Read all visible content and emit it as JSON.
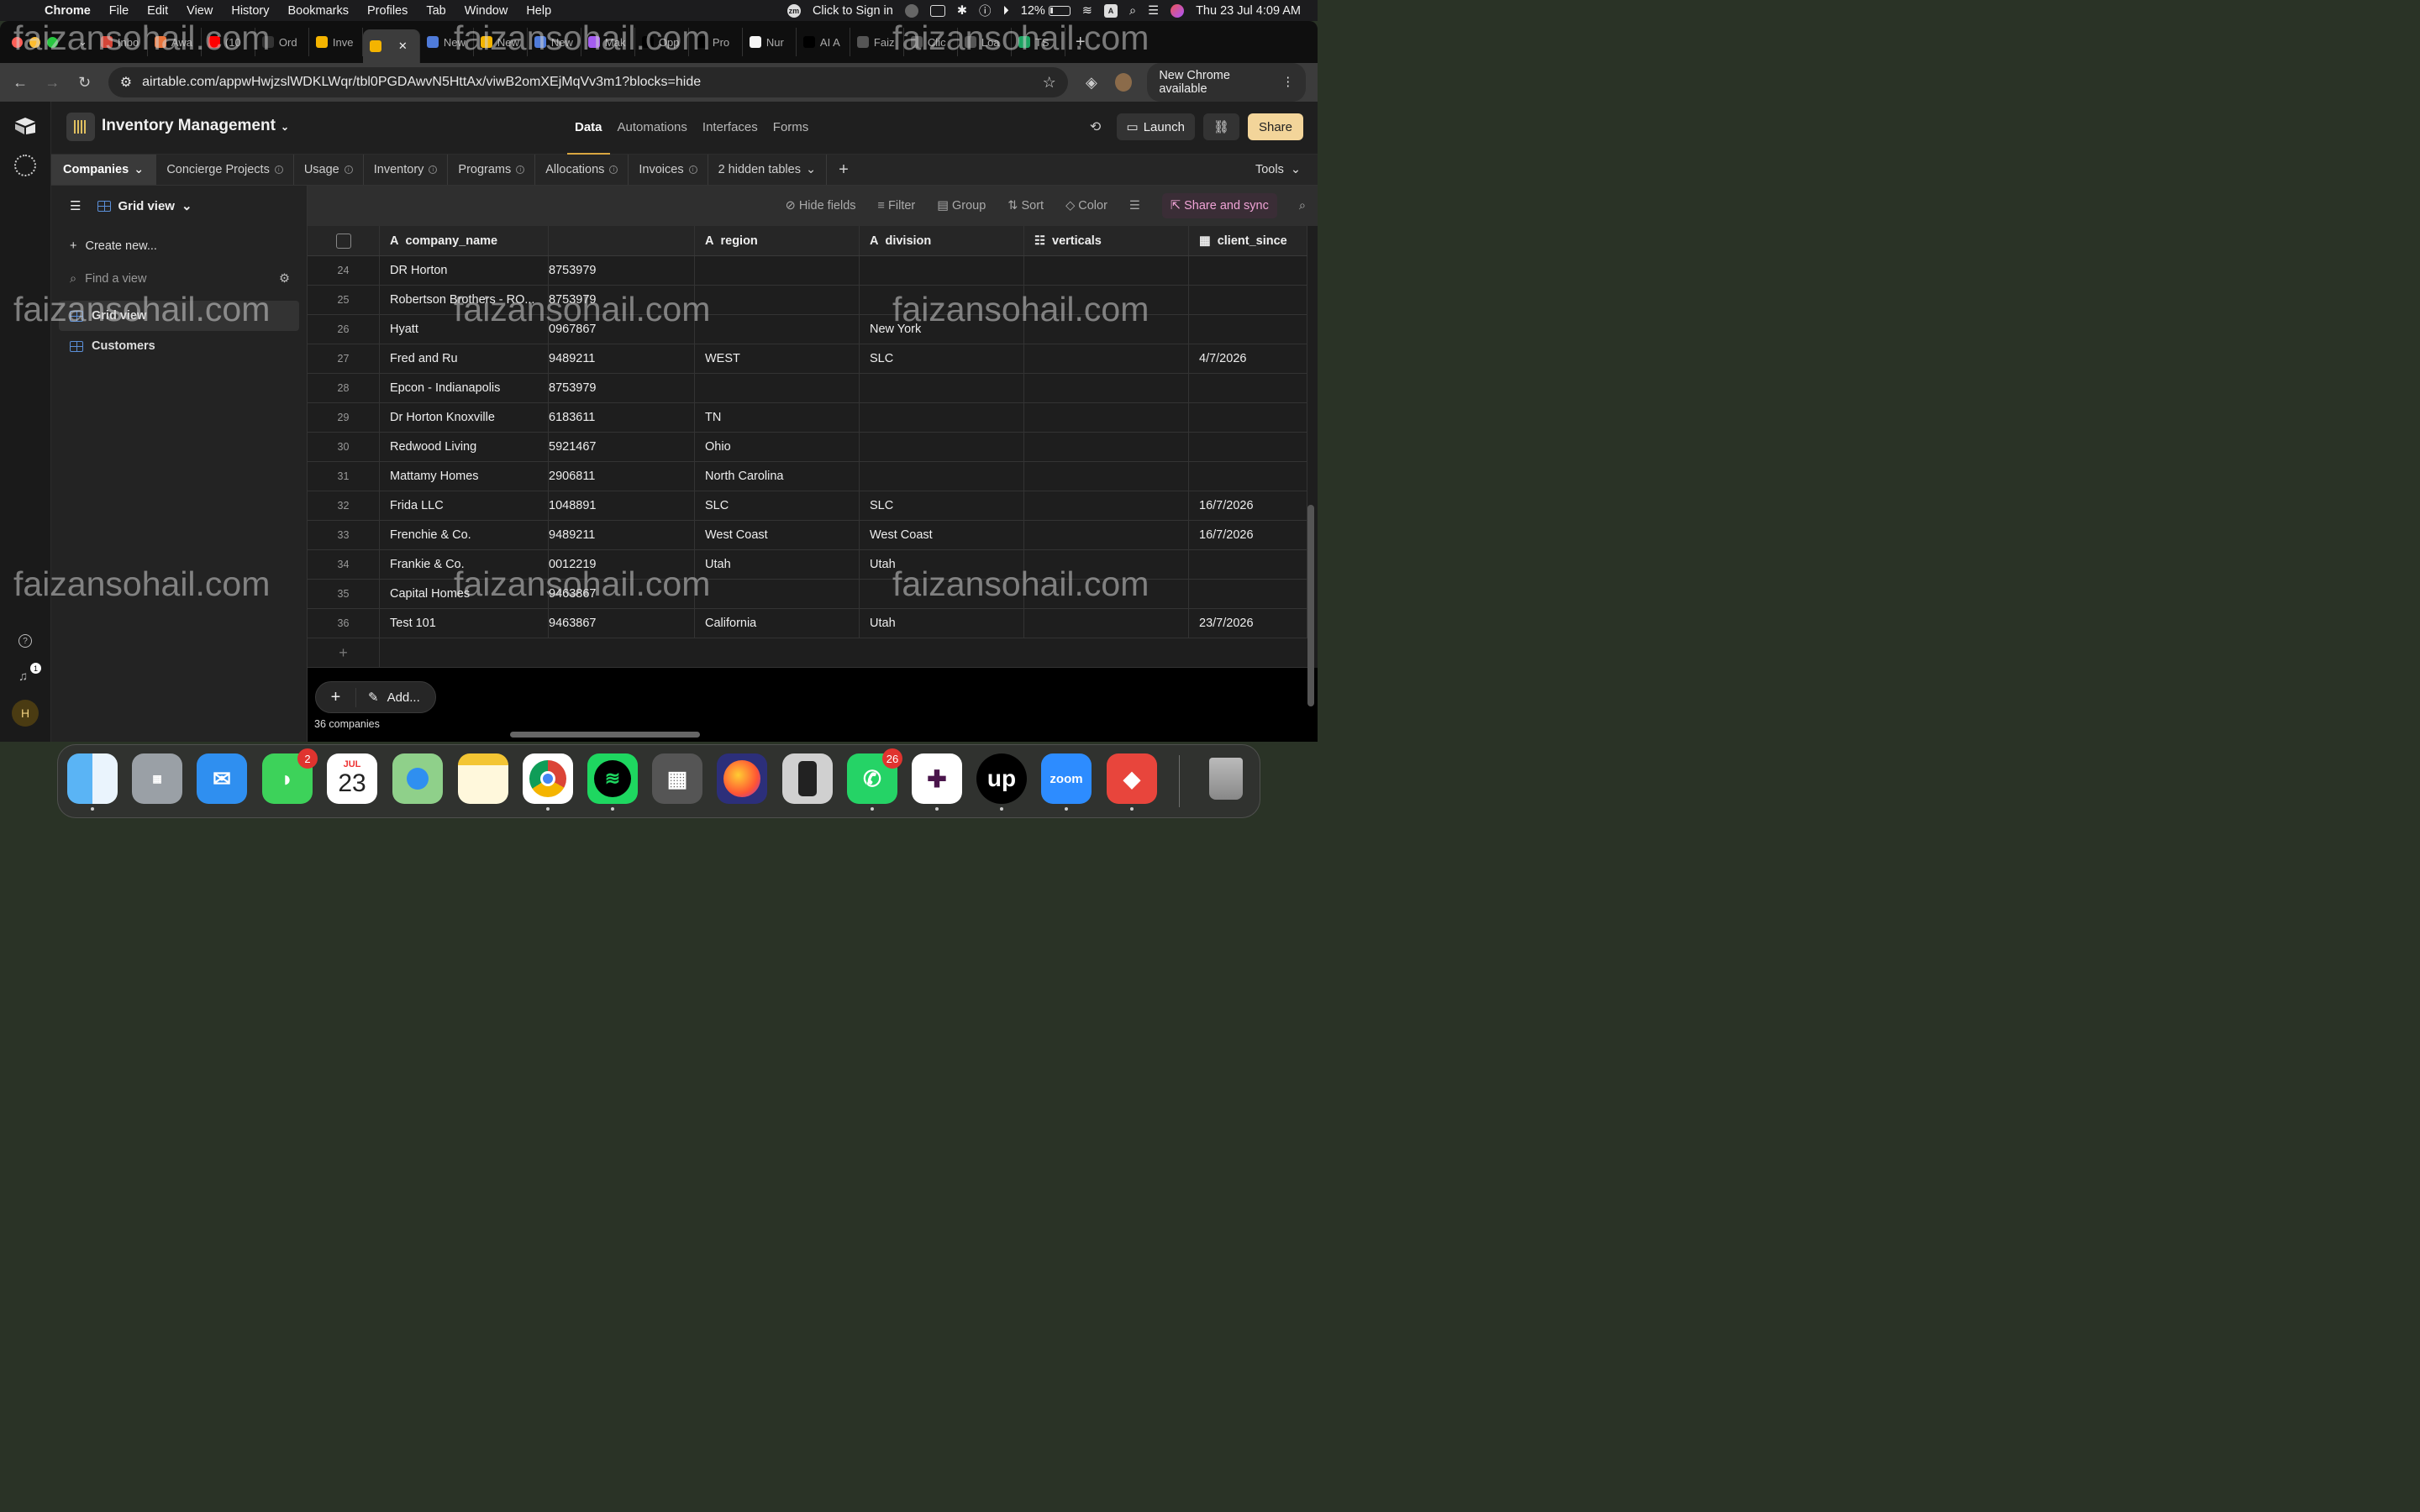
{
  "menubar": {
    "app": "Chrome",
    "items": [
      "File",
      "Edit",
      "View",
      "History",
      "Bookmarks",
      "Profiles",
      "Tab",
      "Window",
      "Help"
    ],
    "zm": "zm",
    "signin": "Click to Sign in",
    "battery": "12%",
    "input": "A",
    "datetime": "Thu 23 Jul  4:09 AM"
  },
  "browser": {
    "tabs": [
      {
        "label": "Inbo",
        "color": "#d44638"
      },
      {
        "label": "Awa",
        "color": "#e8743b"
      },
      {
        "label": "(10",
        "color": "#ff0000"
      },
      {
        "label": "Ord",
        "color": "#333333"
      },
      {
        "label": "Inve",
        "color": "#f4b400"
      },
      {
        "label": "New",
        "color": "#4f7bd9"
      },
      {
        "label": "New",
        "color": "#f4b400"
      },
      {
        "label": "New",
        "color": "#4f7bd9"
      },
      {
        "label": "Mak",
        "color": "#a45cf0"
      },
      {
        "label": "Opp",
        "color": "#000000"
      },
      {
        "label": "Pro",
        "color": "#000000"
      },
      {
        "label": "Nur",
        "color": "#f5f5f5"
      },
      {
        "label": "AI A",
        "color": "#000000"
      },
      {
        "label": "Faiz",
        "color": "#555555"
      },
      {
        "label": "Clic",
        "color": "#555555"
      },
      {
        "label": "Loa",
        "color": "#555555"
      },
      {
        "label": "TS",
        "color": "#1da462"
      }
    ],
    "url": "airtable.com/appwHwjzslWDKLWqr/tbl0PGDAwvN5HttAx/viwB2omXEjMqVv3m1?blocks=hide",
    "update": "New Chrome available"
  },
  "base": {
    "name": "Inventory Management",
    "nav": [
      "Data",
      "Automations",
      "Interfaces",
      "Forms"
    ],
    "launch": "Launch",
    "share": "Share"
  },
  "tables": {
    "active": "Companies",
    "items": [
      "Concierge Projects",
      "Usage",
      "Inventory",
      "Programs",
      "Allocations",
      "Invoices"
    ],
    "hidden": "2 hidden tables",
    "tools": "Tools"
  },
  "sidebar": {
    "view_name": "Grid view",
    "create": "Create new...",
    "find_placeholder": "Find a view",
    "views": [
      "Grid view",
      "Customers"
    ]
  },
  "viewbar": {
    "hide_fields": "Hide fields",
    "filter": "Filter",
    "group": "Group",
    "sort": "Sort",
    "color": "Color",
    "share_sync": "Share and sync"
  },
  "grid": {
    "columns": [
      "company_name",
      "",
      "region",
      "division",
      "verticals",
      "client_since"
    ],
    "rows": [
      {
        "n": "24",
        "name": "DR Horton",
        "id": "8753979",
        "region": "",
        "division": "",
        "verticals": "",
        "since": ""
      },
      {
        "n": "25",
        "name": "Robertson Brothers - RO...",
        "id": "8753979",
        "region": "",
        "division": "",
        "verticals": "",
        "since": ""
      },
      {
        "n": "26",
        "name": "Hyatt",
        "id": "0967867",
        "region": "",
        "division": "New York",
        "verticals": "",
        "since": ""
      },
      {
        "n": "27",
        "name": "Fred and Ru",
        "id": "9489211",
        "region": "WEST",
        "division": "SLC",
        "verticals": "",
        "since": "4/7/2026"
      },
      {
        "n": "28",
        "name": "Epcon - Indianapolis",
        "id": "8753979",
        "region": "",
        "division": "",
        "verticals": "",
        "since": ""
      },
      {
        "n": "29",
        "name": "Dr Horton Knoxville",
        "id": "6183611",
        "region": "TN",
        "division": "",
        "verticals": "",
        "since": ""
      },
      {
        "n": "30",
        "name": "Redwood Living",
        "id": "5921467",
        "region": "Ohio",
        "division": "",
        "verticals": "",
        "since": ""
      },
      {
        "n": "31",
        "name": "Mattamy Homes",
        "id": "2906811",
        "region": "North Carolina",
        "division": "",
        "verticals": "",
        "since": ""
      },
      {
        "n": "32",
        "name": "Frida LLC",
        "id": "1048891",
        "region": "SLC",
        "division": "SLC",
        "verticals": "",
        "since": "16/7/2026"
      },
      {
        "n": "33",
        "name": "Frenchie & Co.",
        "id": "9489211",
        "region": "West Coast",
        "division": "West Coast",
        "verticals": "",
        "since": "16/7/2026"
      },
      {
        "n": "34",
        "name": "Frankie & Co.",
        "id": "0012219",
        "region": "Utah",
        "division": "Utah",
        "verticals": "",
        "since": ""
      },
      {
        "n": "35",
        "name": "Capital Homes",
        "id": "9463867",
        "region": "",
        "division": "",
        "verticals": "",
        "since": ""
      },
      {
        "n": "36",
        "name": "Test 101",
        "id": "9463867",
        "region": "California",
        "division": "Utah",
        "verticals": "",
        "since": "23/7/2026"
      }
    ],
    "add_label": "Add...",
    "record_count": "36 companies"
  },
  "watermark": "faizansohail.com",
  "rail": {
    "notifications": "1",
    "avatar": "H"
  },
  "dock": {
    "calendar_month": "JUL",
    "calendar_day": "23",
    "messages_badge": "2",
    "whatsapp_badge": "26",
    "upwork": "up",
    "zoom": "zoom"
  }
}
